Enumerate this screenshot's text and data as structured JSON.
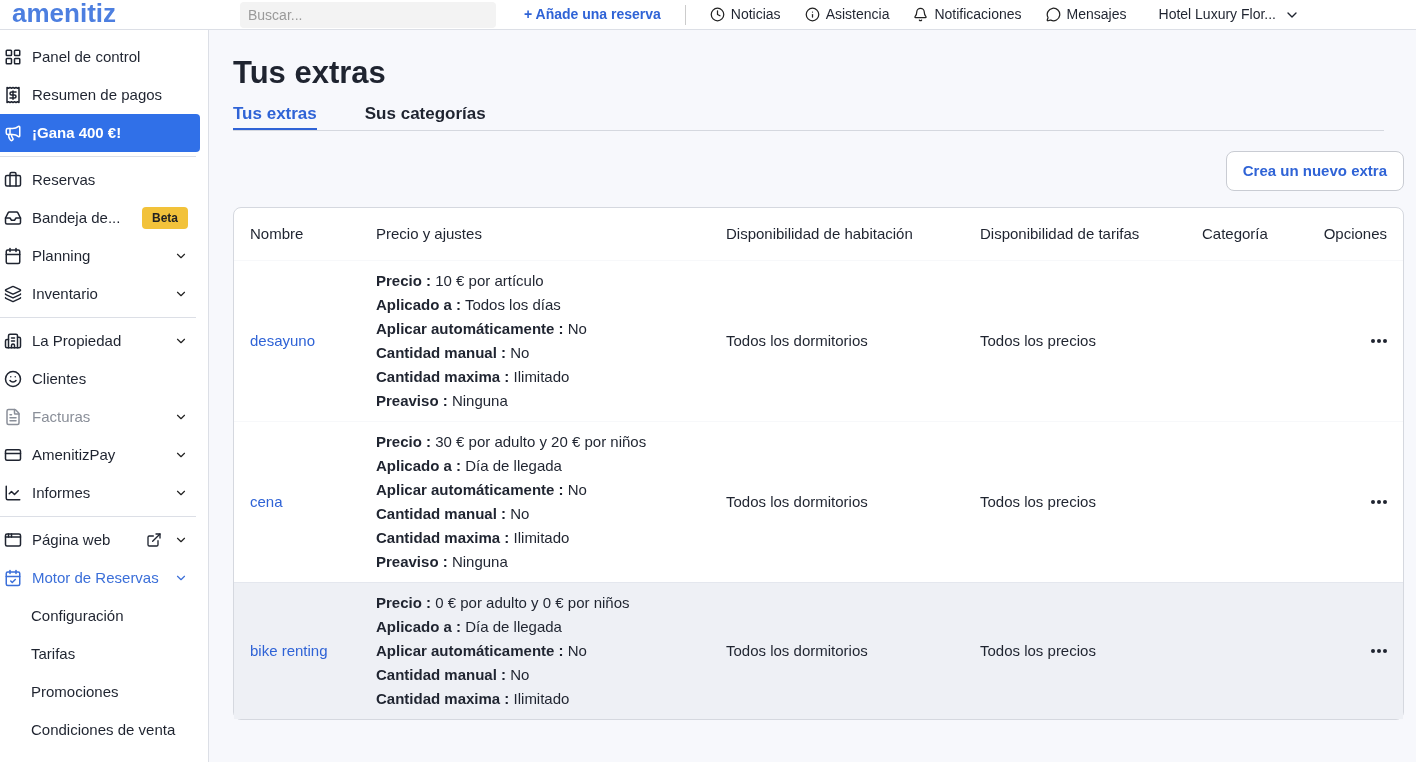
{
  "topbar": {
    "logo": "amenitiz",
    "search": {
      "placeholder": "Buscar..."
    },
    "add_booking": "+ Añade una reserva",
    "links": [
      "Noticias",
      "Asistencia",
      "Notificaciones",
      "Mensajes"
    ],
    "hotel": "Hotel Luxury Flor..."
  },
  "sidebar": {
    "groups": [
      [
        {
          "label": "Panel de control",
          "kind": "item",
          "selected": false,
          "disabled": false,
          "expandable": false
        },
        {
          "label": "Resumen de pagos",
          "kind": "item",
          "selected": false,
          "disabled": false,
          "expandable": false
        },
        {
          "label": "¡Gana 400 €!",
          "kind": "promo"
        }
      ],
      [
        {
          "label": "Reservas",
          "kind": "item",
          "selected": false,
          "disabled": false,
          "expandable": false
        },
        {
          "label": "Bandeja de...",
          "kind": "item",
          "selected": false,
          "disabled": false,
          "expandable": false,
          "badge": "Beta"
        },
        {
          "label": "Planning",
          "kind": "item",
          "selected": false,
          "disabled": false,
          "expandable": true
        },
        {
          "label": "Inventario",
          "kind": "item",
          "selected": false,
          "disabled": false,
          "expandable": true
        }
      ],
      [
        {
          "label": "La Propiedad",
          "kind": "item",
          "selected": false,
          "disabled": false,
          "expandable": true
        },
        {
          "label": "Clientes",
          "kind": "item",
          "selected": false,
          "disabled": false,
          "expandable": false
        },
        {
          "label": "Facturas",
          "kind": "item",
          "selected": false,
          "disabled": true,
          "expandable": true
        },
        {
          "label": "AmenitizPay",
          "kind": "item",
          "selected": false,
          "disabled": false,
          "expandable": true
        },
        {
          "label": "Informes",
          "kind": "item",
          "selected": false,
          "disabled": false,
          "expandable": true
        }
      ],
      [
        {
          "label": "Página web",
          "kind": "item",
          "selected": false,
          "disabled": false,
          "expandable": true,
          "external": true
        },
        {
          "label": "Motor de Reservas",
          "kind": "item",
          "selected": true,
          "disabled": false,
          "expandable": true,
          "children": [
            "Configuración",
            "Tarifas",
            "Promociones",
            "Condiciones de venta"
          ]
        }
      ]
    ]
  },
  "page": {
    "title": "Tus extras",
    "tabs": [
      {
        "label": "Tus extras",
        "selected": true
      },
      {
        "label": "Sus categorías",
        "selected": false
      }
    ],
    "create_button": "Crea un nuevo extra"
  },
  "table": {
    "columns": [
      "Nombre",
      "Precio y ajustes",
      "Disponibilidad de habitación",
      "Disponibilidad de tarifas",
      "Categoría",
      "Opciones"
    ],
    "rows": [
      {
        "name": "desayuno",
        "hovered": false,
        "rooms": "Todos los dormitorios",
        "rates": "Todos los precios",
        "settings": [
          {
            "label": "Precio :",
            "value": "10 € por artículo"
          },
          {
            "label": "Aplicado a :",
            "value": "Todos los días"
          },
          {
            "label": "Aplicar automáticamente :",
            "value": "No"
          },
          {
            "label": "Cantidad manual :",
            "value": "No"
          },
          {
            "label": "Cantidad maxima :",
            "value": "Ilimitado"
          },
          {
            "label": "Preaviso :",
            "value": "Ninguna"
          }
        ]
      },
      {
        "name": "cena",
        "hovered": false,
        "rooms": "Todos los dormitorios",
        "rates": "Todos los precios",
        "settings": [
          {
            "label": "Precio :",
            "value": "30 € por adulto y 20 € por niños"
          },
          {
            "label": "Aplicado a :",
            "value": "Día de llegada"
          },
          {
            "label": "Aplicar automáticamente :",
            "value": "No"
          },
          {
            "label": "Cantidad manual :",
            "value": "No"
          },
          {
            "label": "Cantidad maxima :",
            "value": "Ilimitado"
          },
          {
            "label": "Preaviso :",
            "value": "Ninguna"
          }
        ]
      },
      {
        "name": "bike renting",
        "hovered": true,
        "rooms": "Todos los dormitorios",
        "rates": "Todos los precios",
        "settings": [
          {
            "label": "Precio :",
            "value": "0 € por adulto y 0 € por niños"
          },
          {
            "label": "Aplicado a :",
            "value": "Día de llegada"
          },
          {
            "label": "Aplicar automáticamente :",
            "value": "No"
          },
          {
            "label": "Cantidad manual :",
            "value": "No"
          },
          {
            "label": "Cantidad maxima :",
            "value": "Ilimitado"
          }
        ]
      }
    ]
  }
}
